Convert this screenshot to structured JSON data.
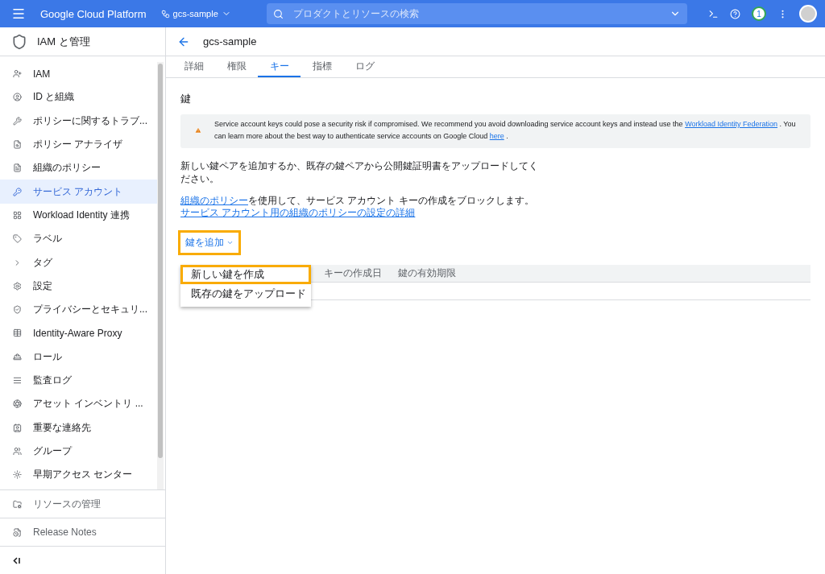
{
  "header": {
    "product": "Google Cloud Platform",
    "project": "gcs-sample",
    "search": {
      "placeholder": "プロダクトとリソースの検索"
    },
    "notification_badge": "1"
  },
  "sidebar": {
    "title": "IAM と管理",
    "items": [
      {
        "label": "IAM",
        "selected": false
      },
      {
        "label": "ID と組織",
        "selected": false
      },
      {
        "label": "ポリシーに関するトラブ...",
        "selected": false
      },
      {
        "label": "ポリシー アナライザ",
        "selected": false
      },
      {
        "label": "組織のポリシー",
        "selected": false
      },
      {
        "label": "サービス アカウント",
        "selected": true
      },
      {
        "label": "Workload Identity 連携",
        "selected": false
      },
      {
        "label": "ラベル",
        "selected": false
      },
      {
        "label": "タグ",
        "selected": false
      },
      {
        "label": "設定",
        "selected": false
      },
      {
        "label": "プライバシーとセキュリ...",
        "selected": false
      },
      {
        "label": "Identity-Aware Proxy",
        "selected": false
      },
      {
        "label": "ロール",
        "selected": false
      },
      {
        "label": "監査ログ",
        "selected": false
      },
      {
        "label": "アセット インベントリ ...",
        "selected": false
      },
      {
        "label": "重要な連絡先",
        "selected": false
      },
      {
        "label": "グループ",
        "selected": false
      },
      {
        "label": "早期アクセス センター",
        "selected": false
      }
    ],
    "footer_items": [
      {
        "label": "リソースの管理"
      },
      {
        "label": "Release Notes"
      }
    ]
  },
  "page": {
    "title": "gcs-sample",
    "tabs": [
      {
        "label": "詳細",
        "selected": false
      },
      {
        "label": "権限",
        "selected": false
      },
      {
        "label": "キー",
        "selected": true
      },
      {
        "label": "指標",
        "selected": false
      },
      {
        "label": "ログ",
        "selected": false
      }
    ],
    "section_title": "鍵",
    "alert": {
      "text_1": "Service account keys could pose a security risk if compromised. We recommend you avoid downloading service account keys and instead use the ",
      "link_1": "Workload Identity Federation",
      "text_2": " . You can learn more about the best way to authenticate service accounts on Google Cloud ",
      "link_2": "here",
      "text_3": " ."
    },
    "description": "新しい鍵ペアを追加するか、既存の鍵ペアから公開鍵証明書をアップロードしてください。",
    "policy": {
      "link": "組織のポリシー",
      "text": "を使用して、サービス アカウント キーの作成をブロックします。",
      "details_link": "サービス アカウント用の組織のポリシーの設定の詳細"
    },
    "add_key_button": {
      "label": "鍵を追加",
      "highlighted": true
    },
    "menu": [
      {
        "label": "新しい鍵を作成",
        "highlighted": true
      },
      {
        "label": "既存の鍵をアップロード",
        "highlighted": false
      }
    ],
    "table": {
      "columns": [
        "キーの作成日",
        "鍵の有効期限"
      ]
    }
  }
}
